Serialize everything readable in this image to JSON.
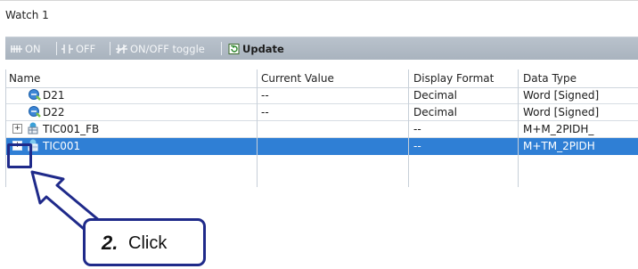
{
  "window": {
    "title": "Watch 1"
  },
  "toolbar": {
    "on_label": "ON",
    "off_label": "OFF",
    "toggle_label": "ON/OFF toggle",
    "update_label": "Update"
  },
  "grid": {
    "columns": [
      "Name",
      "Current Value",
      "Display Format",
      "Data Type"
    ],
    "rows": [
      {
        "name": "D21",
        "current_value": "--",
        "display_format": "Decimal",
        "data_type": "Word [Signed]",
        "icon": "device-icon",
        "expandable": false,
        "selected": false
      },
      {
        "name": "D22",
        "current_value": "--",
        "display_format": "Decimal",
        "data_type": "Word [Signed]",
        "icon": "device-icon",
        "expandable": false,
        "selected": false
      },
      {
        "name": "TIC001_FB",
        "current_value": "",
        "display_format": "--",
        "data_type": "M+M_2PIDH_",
        "icon": "structure-icon",
        "expandable": true,
        "selected": false
      },
      {
        "name": "TIC001",
        "current_value": "",
        "display_format": "--",
        "data_type": "M+TM_2PIDH",
        "icon": "structure-icon",
        "expandable": true,
        "selected": true
      }
    ]
  },
  "annotation": {
    "step_number": "2.",
    "step_text": "Click"
  },
  "colors": {
    "selection": "#2f7fd5",
    "callout_border": "#1f2a8a",
    "toolbar_bg": "#b0bac5"
  }
}
